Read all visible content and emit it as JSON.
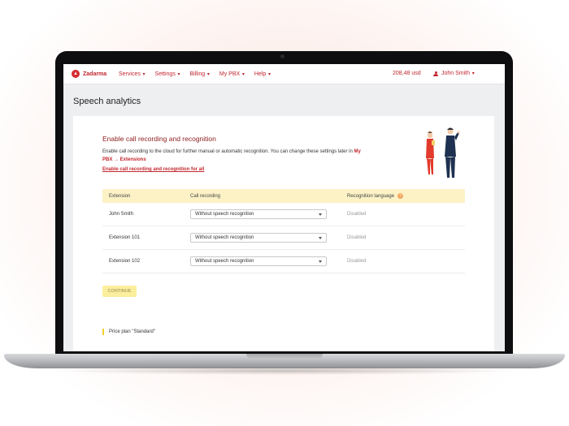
{
  "nav": {
    "logo_text": "Zadarma",
    "menu": [
      "Services",
      "Settings",
      "Billing",
      "My PBX",
      "Help"
    ],
    "balance": "208,48 usd",
    "user_name": "John Smith"
  },
  "page": {
    "title": "Speech analytics"
  },
  "card": {
    "title": "Enable call recording and recognition",
    "description": "Enable call recording to the cloud for further manual or automatic recognition. You can change these settings later in",
    "description_link": "My PBX → Extensions",
    "enable_all": "Enable call recording and recognition for all"
  },
  "table": {
    "headers": [
      "Extension",
      "Call recording",
      "Recognition language"
    ],
    "rows": [
      {
        "extension": "John Smith",
        "recording": "Without speech recognition",
        "language": "Disabled"
      },
      {
        "extension": "Extension 101",
        "recording": "Without speech recognition",
        "language": "Disabled"
      },
      {
        "extension": "Extension 102",
        "recording": "Without speech recognition",
        "language": "Disabled"
      }
    ]
  },
  "continue_label": "CONTINUE",
  "price_plan": "Price plan \"Standard\"",
  "colors": {
    "brand": "#c2262e",
    "highlight": "#fcf2c6",
    "button": "#fbef9d"
  }
}
